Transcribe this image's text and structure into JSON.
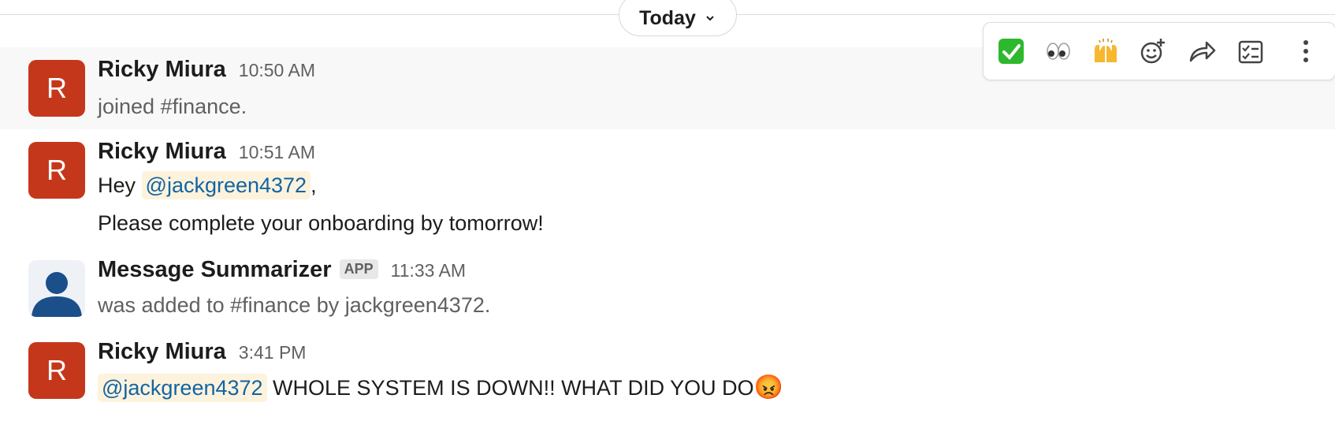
{
  "divider": {
    "label": "Today"
  },
  "messages": [
    {
      "avatar_letter": "R",
      "author": "Ricky Miura",
      "time": "10:50 AM",
      "text": "joined #finance."
    },
    {
      "avatar_letter": "R",
      "author": "Ricky Miura",
      "time": "10:51 AM",
      "line1_prefix": "Hey ",
      "mention": "@jackgreen4372",
      "line1_suffix": ",",
      "line2": "Please complete your onboarding by tomorrow!"
    },
    {
      "author": "Message Summarizer",
      "badge": "APP",
      "time": "11:33 AM",
      "text": "was added to #finance by jackgreen4372."
    },
    {
      "avatar_letter": "R",
      "author": "Ricky Miura",
      "time": "3:41 PM",
      "mention": "@jackgreen4372",
      "text": " WHOLE SYSTEM IS DOWN!! WHAT DID YOU DO",
      "emoji": "😡"
    }
  ],
  "actions": [
    "check-mark-emoji",
    "eyes-emoji",
    "raised-hands-emoji",
    "add-reaction-icon",
    "forward-icon",
    "save-task-icon",
    "more-actions-icon"
  ],
  "colors": {
    "avatar": "#c5371b",
    "mention_bg": "#fdf3dd",
    "mention_text": "#1264a3",
    "app_avatar_person": "#1b4f8a"
  }
}
